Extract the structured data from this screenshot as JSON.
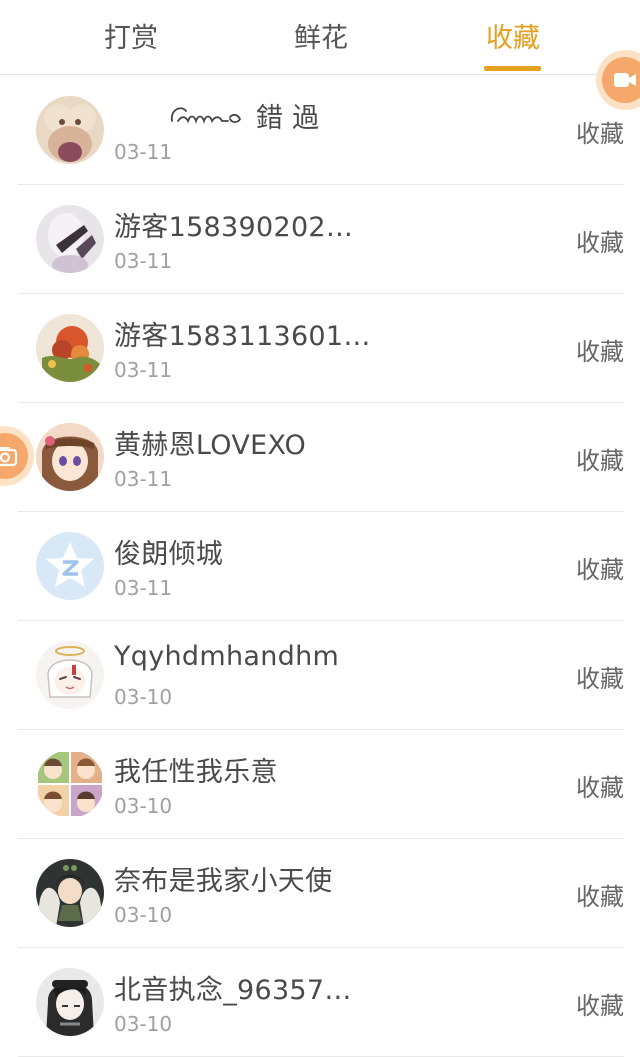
{
  "tabs": [
    {
      "label": "打赏",
      "active": false
    },
    {
      "label": "鲜花",
      "active": false
    },
    {
      "label": "收藏",
      "active": true
    }
  ],
  "accent_color": "#e4a020",
  "fab_color": "#f6a76c",
  "action_label": "收藏",
  "rows": [
    {
      "name": "錯 過",
      "date": "03-11",
      "avatar": "avatar-1"
    },
    {
      "name": "游客158390202…",
      "date": "03-11",
      "avatar": "avatar-2"
    },
    {
      "name": "游客1583113601…",
      "date": "03-11",
      "avatar": "avatar-3"
    },
    {
      "name": "黄赫恩LOVEXO",
      "date": "03-11",
      "avatar": "avatar-4"
    },
    {
      "name": "俊朗倾城",
      "date": "03-11",
      "avatar": "default-avatar"
    },
    {
      "name": "Yqyhdmhandhm",
      "date": "03-10",
      "avatar": "avatar-6"
    },
    {
      "name": "我任性我乐意",
      "date": "03-10",
      "avatar": "avatar-7"
    },
    {
      "name": "奈布是我家小天使",
      "date": "03-10",
      "avatar": "avatar-8"
    },
    {
      "name": "北音执念_96357…",
      "date": "03-10",
      "avatar": "avatar-9"
    }
  ]
}
